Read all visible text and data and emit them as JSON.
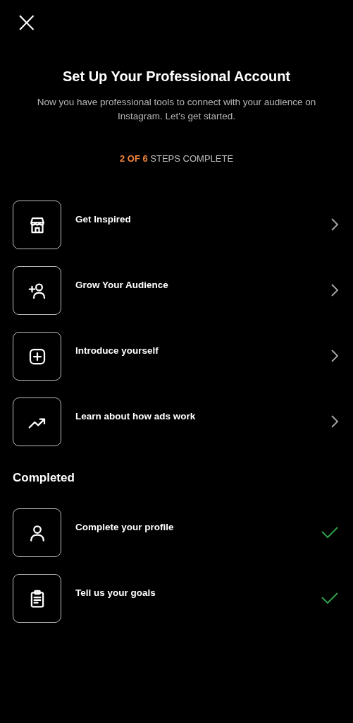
{
  "header": {
    "close": "×"
  },
  "title": "Set Up Your Professional Account",
  "subtitle": "Now you have professional tools to connect with your audience on Instagram. Let's get started.",
  "progress": {
    "count": "2 OF 6",
    "label": "STEPS COMPLETE"
  },
  "steps": [
    {
      "label": "Get Inspired",
      "kind": "store",
      "completed": false
    },
    {
      "label": "Grow Your Audience",
      "kind": "audience",
      "completed": false
    },
    {
      "label": "Introduce yourself",
      "kind": "post",
      "completed": false
    },
    {
      "label": "Learn about how ads work",
      "kind": "ads",
      "completed": false
    }
  ],
  "completed_heading": "Completed",
  "completed_steps": [
    {
      "label": "Complete your profile",
      "kind": "profile",
      "completed": true
    },
    {
      "label": "Tell us your goals",
      "kind": "goals",
      "completed": true
    }
  ]
}
